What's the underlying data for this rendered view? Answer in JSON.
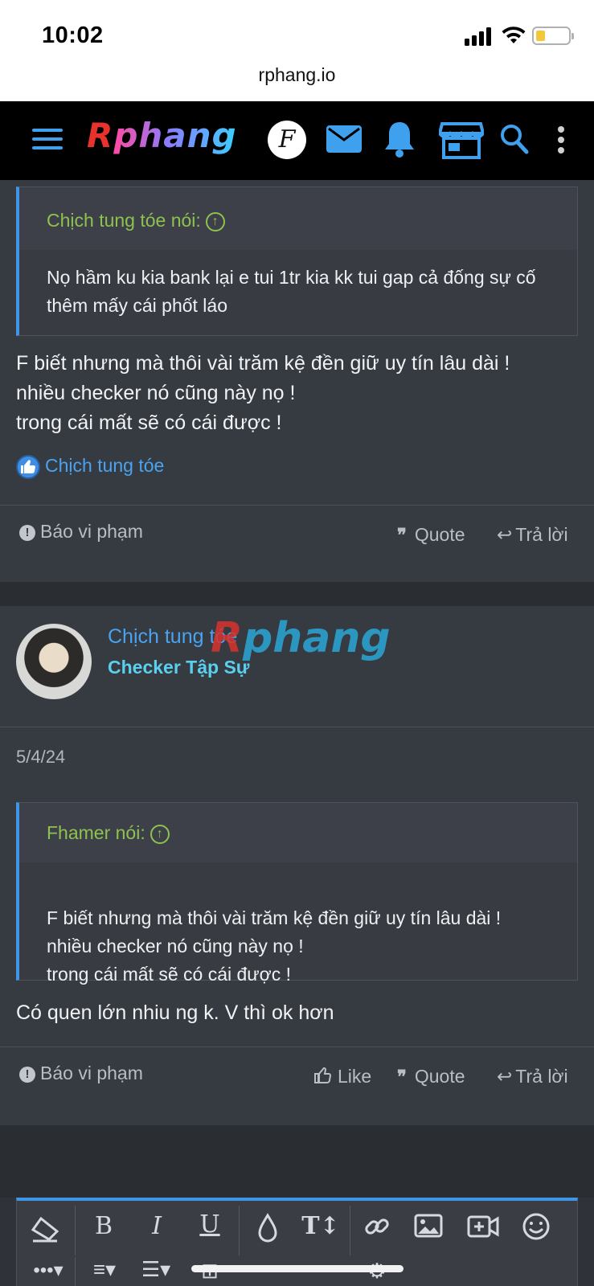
{
  "status_bar": {
    "time": "10:02"
  },
  "browser": {
    "url": "rphang.io"
  },
  "header": {
    "logo_first": "R",
    "logo_rest": "phang",
    "forum_badge": "F",
    "icons": [
      "menu-icon",
      "forum-icon",
      "mail-icon",
      "bell-icon",
      "store-icon",
      "search-icon",
      "more-icon"
    ]
  },
  "post1": {
    "quote_author": "Chịch tung tóe nói:",
    "quote_text": "Nọ hầm ku kia bank lại e tui 1tr kia kk tui gap cả đống sự cố thêm mấy cái phốt láo",
    "message": "F biết nhưng mà thôi vài trăm kệ đền giữ uy tín lâu dài !\nnhiều checker nó cũng này nọ !\ntrong cái mất sẽ có cái được !",
    "liked_by": "Chịch tung tóe",
    "report_label": "Báo vi phạm",
    "quote_label": "Quote",
    "reply_label": "Trả lời"
  },
  "post2": {
    "username": "Chịch tung tóe",
    "user_title": "Checker Tập Sự",
    "date": "5/4/24",
    "quote_author": "Fhamer nói:",
    "quote_text": "F biết nhưng mà thôi vài trăm kệ đền giữ uy tín lâu dài !\nnhiều checker nó cũng này nọ !\ntrong cái mất sẽ có cái được !",
    "message": "Có quen lớn nhiu ng k. V thì ok hơn",
    "report_label": "Báo vi phạm",
    "like_label": "Like",
    "quote_label": "Quote",
    "reply_label": "Trả lời"
  },
  "watermark": {
    "first": "R",
    "rest": "phang"
  },
  "colors": {
    "accent": "#3f96e8",
    "quote_author": "#8ec24f",
    "link": "#4aa3f0",
    "user_title": "#5ad0ee"
  }
}
